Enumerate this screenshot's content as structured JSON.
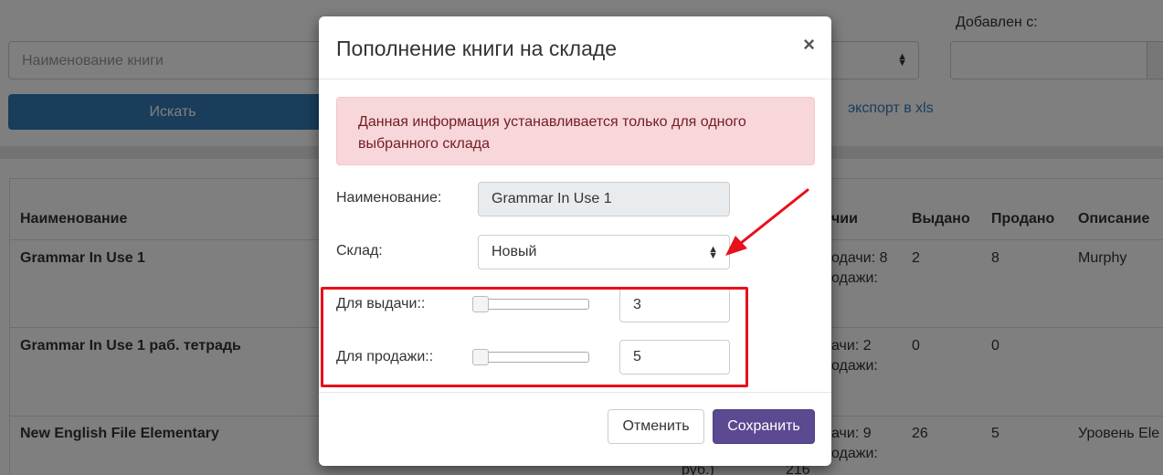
{
  "background": {
    "added_from_label": "Добавлен с:",
    "book_name_placeholder": "Наименование книги",
    "search_button": "Искать",
    "export_link": "экспорт в xls",
    "table_headers": {
      "name": "Наименование",
      "availability": "чии",
      "issued": "Выдано",
      "sold": "Продано",
      "description": "Описание"
    },
    "rows": [
      {
        "name": "Grammar In Use 1",
        "avail_line1": "одачи: 8",
        "avail_line2": "одажи:",
        "issued": "2",
        "sold": "8",
        "description": "Murphy"
      },
      {
        "name": "Grammar In Use 1 раб. тетрадь",
        "avail_line1": "ачи: 2",
        "avail_line2": "одажи:",
        "issued": "0",
        "sold": "0",
        "description": ""
      },
      {
        "name": "New English File Elementary",
        "avail_line1": "ачи: 9",
        "avail_line2": "одажи:",
        "issued": "26",
        "sold": "5",
        "description": "Уровень Ele"
      }
    ],
    "fragments": {
      "price_fragment": "руб.)",
      "number_fragment": "216"
    }
  },
  "modal": {
    "title": "Пополнение книги на складе",
    "close_symbol": "×",
    "alert_text": "Данная информация устанавливается только для одного выбранного склада",
    "name_label": "Наименование:",
    "name_value": "Grammar In Use 1",
    "warehouse_label": "Склад:",
    "warehouse_value": "Новый",
    "issue_label": "Для выдачи::",
    "issue_value": "3",
    "sale_label": "Для продажи::",
    "sale_value": "5",
    "cancel_button": "Отменить",
    "save_button": "Сохранить"
  },
  "colors": {
    "primary": "#337ab7",
    "save": "#5b4a91",
    "alert_bg": "#f8d7da",
    "alert_text": "#721c24",
    "annotation": "#e8101a"
  }
}
